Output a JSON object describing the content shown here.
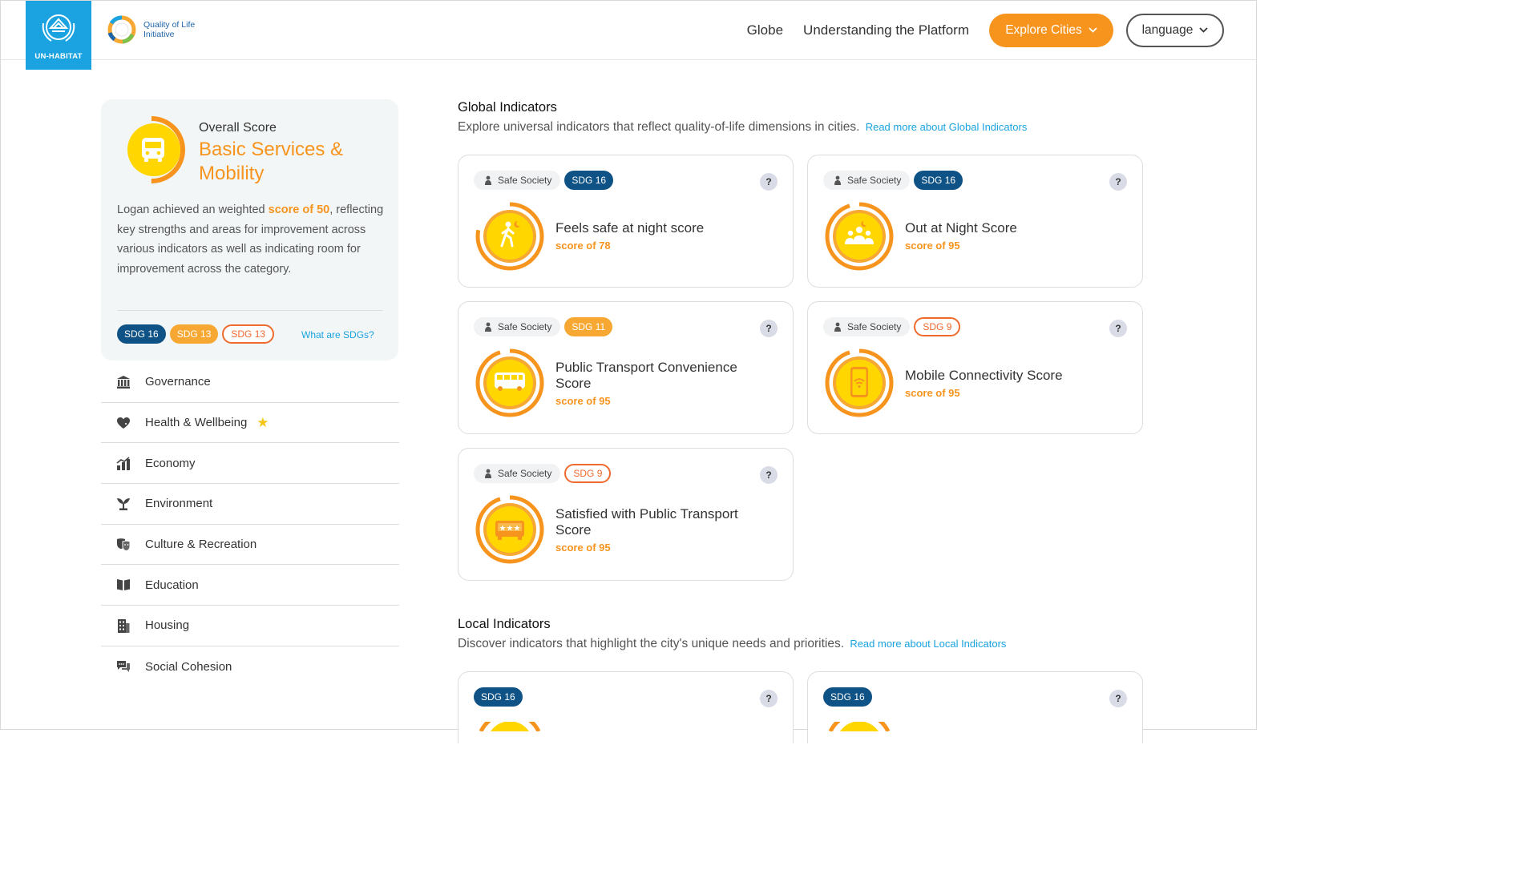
{
  "header": {
    "logo_text": "UN-HABITAT",
    "qol_line1": "Quality of Life",
    "qol_line2": "Initiative",
    "nav": [
      "Globe",
      "Understanding the Platform"
    ],
    "explore_label": "Explore Cities",
    "language_label": "language"
  },
  "overall": {
    "label": "Overall Score",
    "title": "Basic Services & Mobility",
    "desc_before": "Logan achieved an weighted ",
    "desc_score": "score of 50",
    "desc_after": ", reflecting key strengths and areas for improvement across various indicators as well as indicating room for improvement across the category.",
    "score": 50,
    "badges": [
      "SDG 16",
      "SDG 13",
      "SDG 13"
    ],
    "what_sdgs": "What are SDGs?"
  },
  "categories": [
    {
      "label": "Governance",
      "icon": "governance-icon"
    },
    {
      "label": "Health & Wellbeing",
      "icon": "heart-icon"
    },
    {
      "label": "Economy",
      "icon": "economy-icon"
    },
    {
      "label": "Environment",
      "icon": "plant-icon"
    },
    {
      "label": "Culture & Recreation",
      "icon": "masks-icon"
    },
    {
      "label": "Education",
      "icon": "book-icon"
    },
    {
      "label": "Housing",
      "icon": "building-icon"
    },
    {
      "label": "Social Cohesion",
      "icon": "chat-icon"
    }
  ],
  "global": {
    "title": "Global Indicators",
    "subtitle": "Explore universal indicators that reflect quality-of-life dimensions in cities.",
    "link": "Read more about Global Indicators",
    "cards": [
      {
        "tag": "Safe Society",
        "sdg": "SDG 16",
        "name": "Feels safe at night score",
        "score": "score of 78",
        "value": 78,
        "icon": "walking-person-icon"
      },
      {
        "tag": "Safe Society",
        "sdg": "SDG 16",
        "name": "Out at Night Score",
        "score": "score of 95",
        "value": 95,
        "icon": "group-people-icon"
      },
      {
        "tag": "Safe Society",
        "sdg": "SDG 11",
        "name": "Public Transport Convenience Score",
        "score": "score of 95",
        "value": 95,
        "icon": "bus-icon"
      },
      {
        "tag": "Safe Society",
        "sdg": "SDG 9",
        "name": "Mobile Connectivity Score",
        "score": "score of 95",
        "value": 95,
        "icon": "mobile-wifi-icon"
      },
      {
        "tag": "Safe Society",
        "sdg": "SDG 9",
        "name": "Satisfied with Public Transport Score",
        "score": "score of 95",
        "value": 95,
        "icon": "bus-stars-icon"
      }
    ]
  },
  "local": {
    "title": "Local Indicators",
    "subtitle": "Discover indicators that highlight the city's unique needs and priorities.",
    "link": "Read more about Local Indicators",
    "cards": [
      {
        "sdg": "SDG 16"
      },
      {
        "sdg": "SDG 16"
      }
    ]
  },
  "colors": {
    "accent": "#f7941d",
    "unhabitat_blue": "#1aa3e0",
    "sdg_blue": "#0e5286",
    "sdg_orange": "#f7a833",
    "sdg_outline": "#ef6a2d",
    "ring_fill": "#ffd600"
  },
  "help_glyph": "?"
}
